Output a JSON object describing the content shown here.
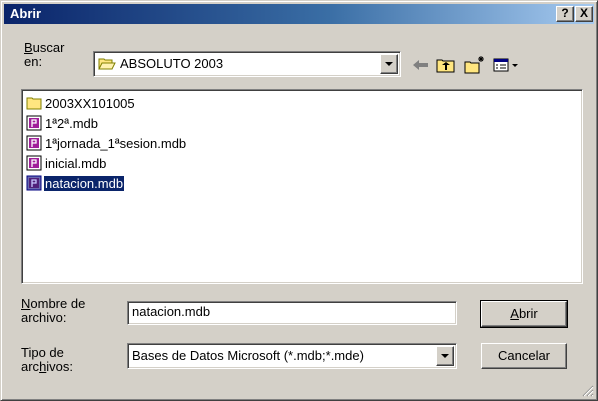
{
  "window": {
    "title": "Abrir",
    "help_label": "?",
    "close_label": "X"
  },
  "lookin": {
    "label_part1": "Buscar",
    "label_part1_access": "B",
    "label_part1_rest": "uscar",
    "label_part2": "en:",
    "value": "ABSOLUTO 2003"
  },
  "toolbar": {
    "back_icon": "back-arrow-icon",
    "up_icon": "up-folder-icon",
    "newfolder_icon": "new-folder-icon",
    "views_icon": "views-menu-icon"
  },
  "files": [
    {
      "name": "2003XX101005",
      "type": "folder"
    },
    {
      "name": "1ª2ª.mdb",
      "type": "mdb"
    },
    {
      "name": "1ªjornada_1ªsesion.mdb",
      "type": "mdb"
    },
    {
      "name": "inicial.mdb",
      "type": "mdb"
    },
    {
      "name": "natacion.mdb",
      "type": "mdb",
      "selected": true
    }
  ],
  "filename": {
    "label_access": "N",
    "label_rest": "ombre de",
    "label_line2": "archivo:",
    "value": "natacion.mdb"
  },
  "filetype": {
    "label_line1": "Tipo de",
    "label_line2_pre": "arc",
    "label_line2_access": "h",
    "label_line2_post": "ivos:",
    "value": "Bases de Datos Microsoft (*.mdb;*.mde)"
  },
  "buttons": {
    "open_access": "A",
    "open_rest": "brir",
    "cancel_label": "Cancelar"
  },
  "colors": {
    "selection": "#0a246a",
    "face": "#d4d0c8",
    "title_start": "#0a246a",
    "title_end": "#a6caf0"
  }
}
